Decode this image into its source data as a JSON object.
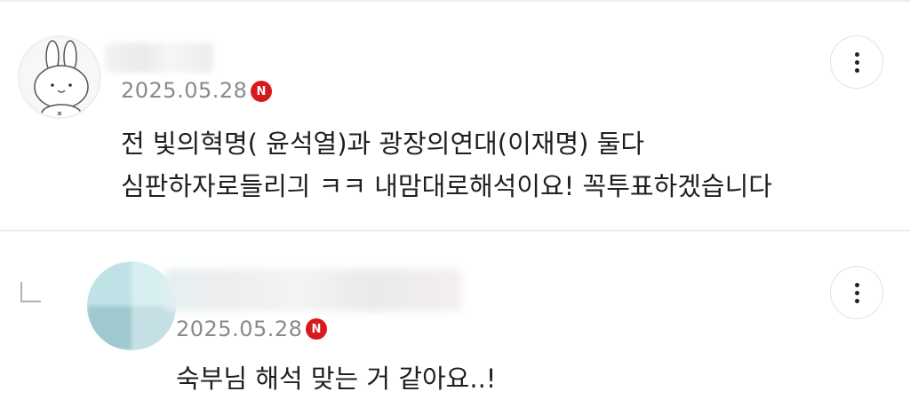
{
  "colors": {
    "badge": "#d71920",
    "date": "#8a8a8a",
    "text": "#1f1f1f"
  },
  "comments": [
    {
      "author_hidden": true,
      "date": "2025.05.28",
      "badge_letter": "N",
      "lines": [
        "전 빛의혁명( 윤석열)과 광장의연대(이재명) 둘다",
        "심판하자로들리긔 ㅋㅋ 내맘대로해석이요! 꼭투표하겠습니다"
      ],
      "more_icon": "more-vertical-icon"
    },
    {
      "is_reply": true,
      "author_hidden": true,
      "date": "2025.05.28",
      "badge_letter": "N",
      "lines": [
        "숙부님 해석 맞는 거 같아요..!"
      ],
      "more_icon": "more-vertical-icon"
    }
  ]
}
